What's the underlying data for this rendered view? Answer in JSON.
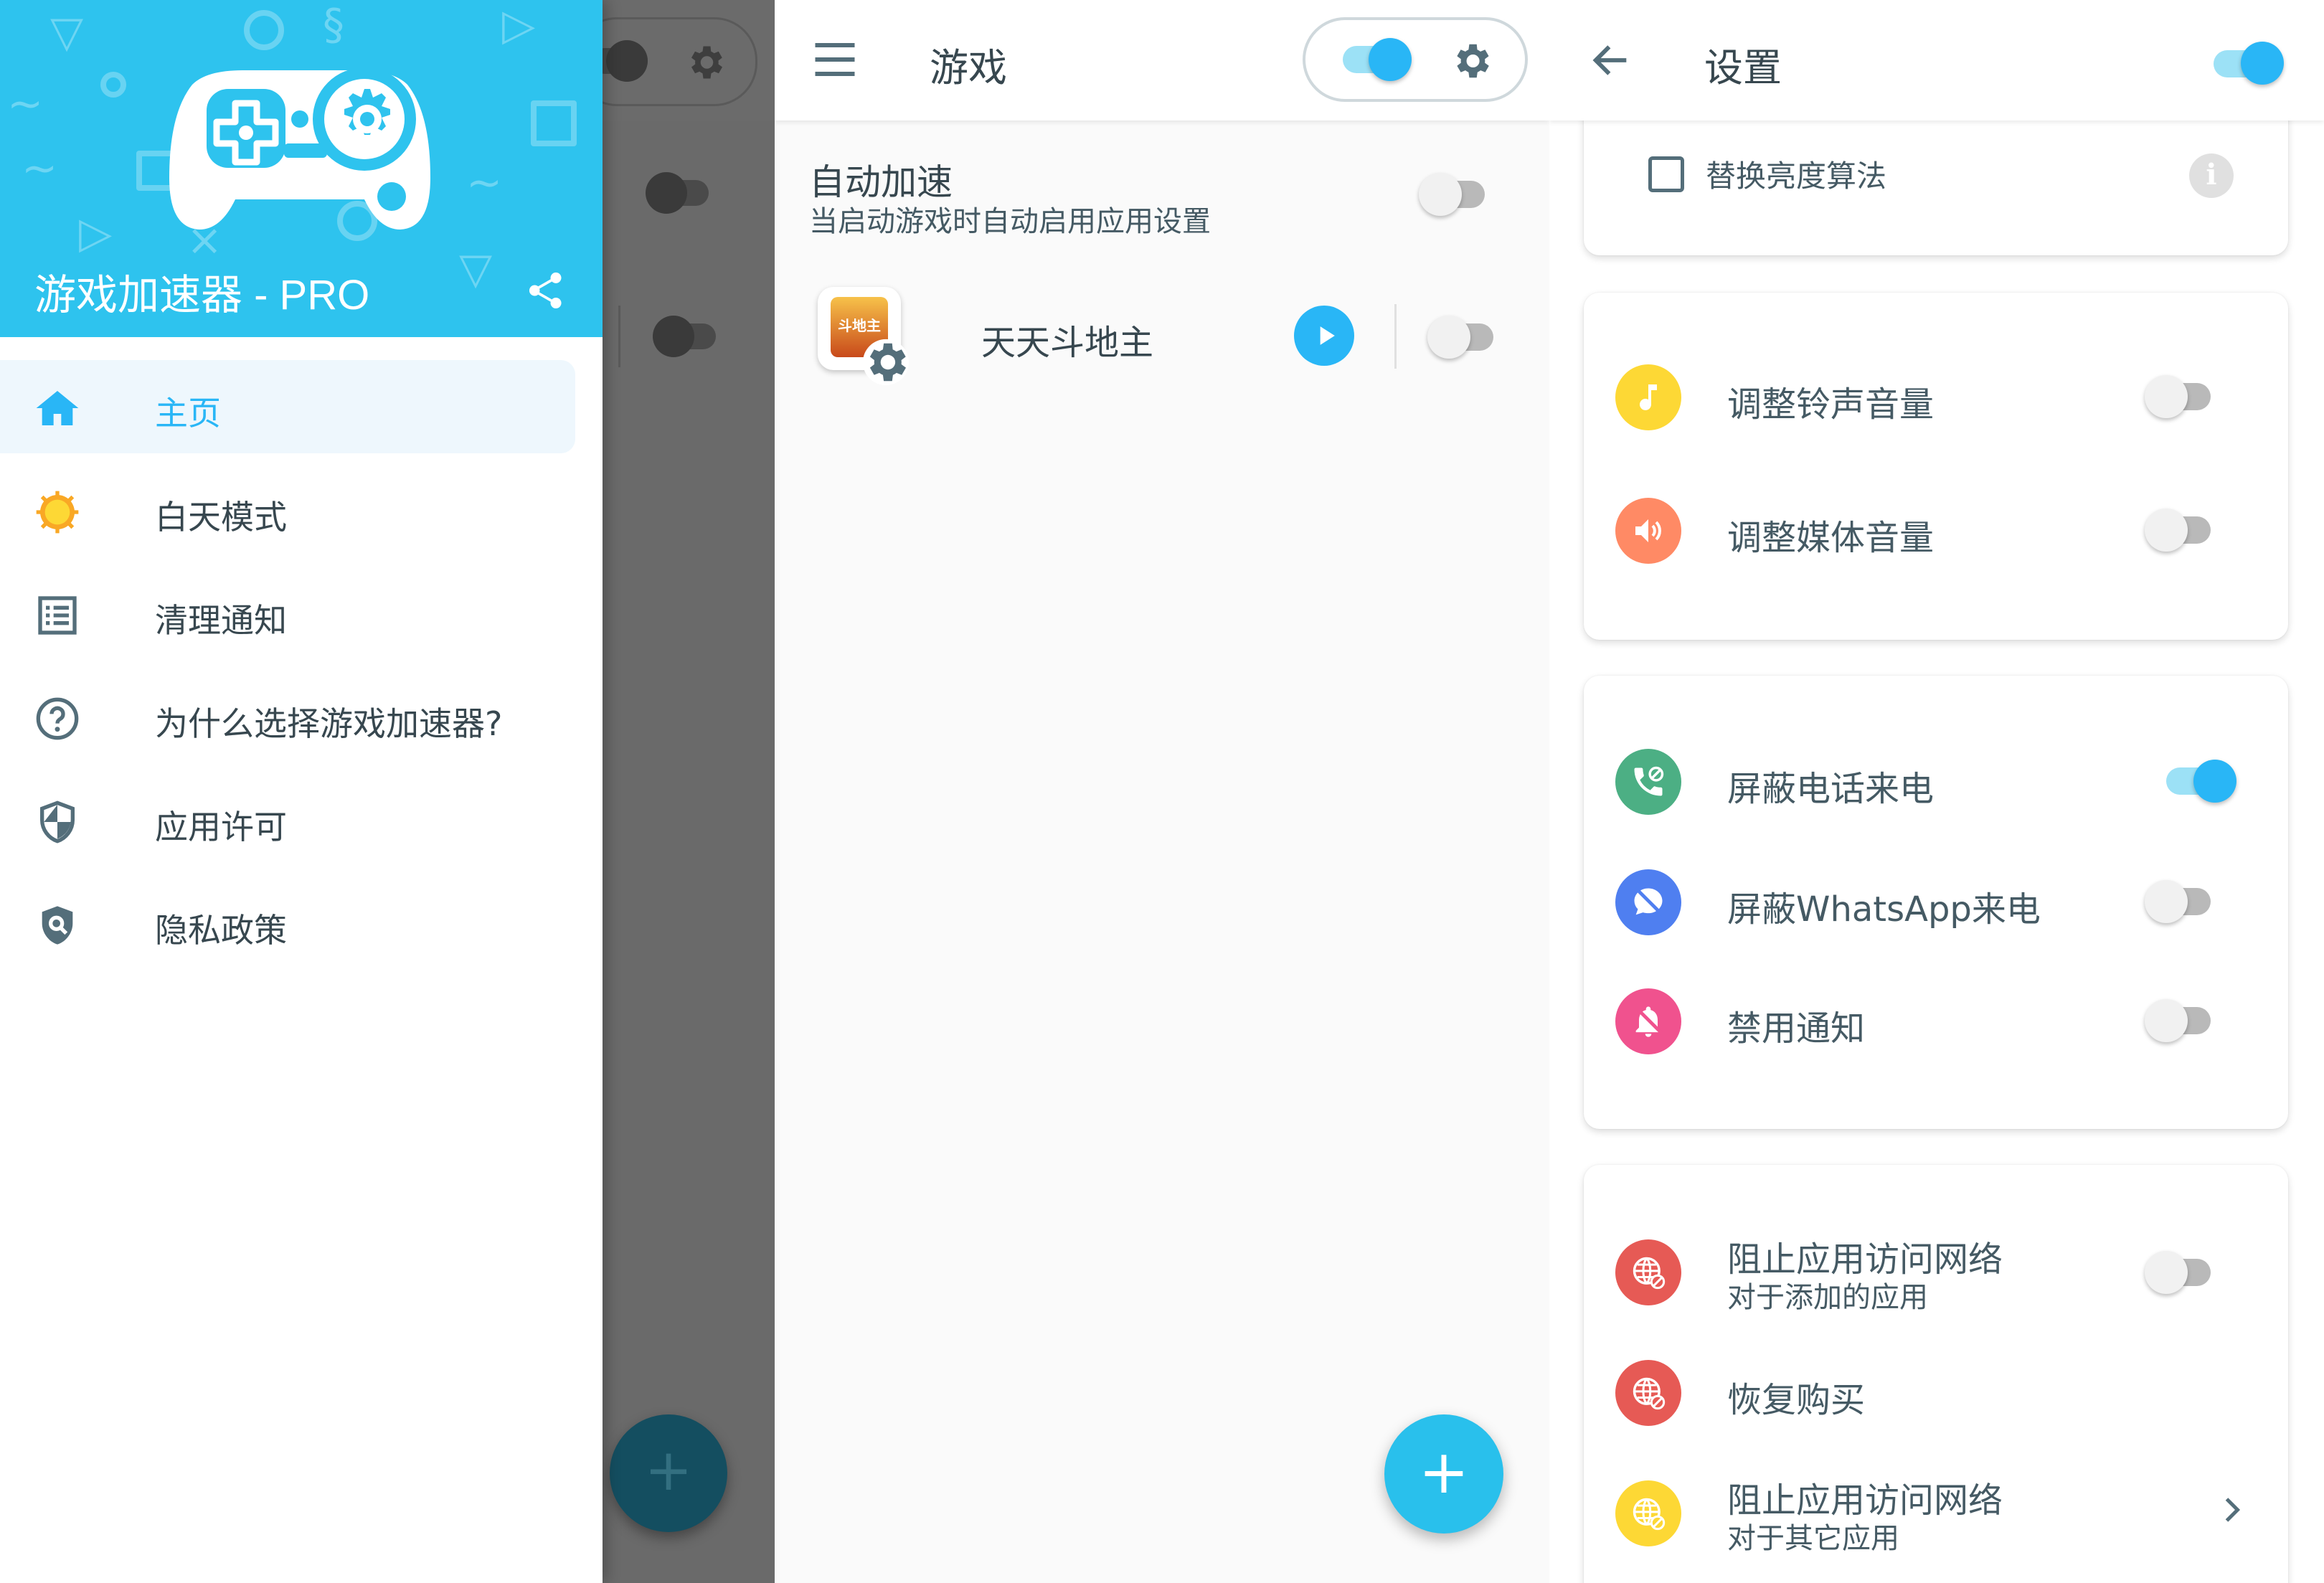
{
  "drawer": {
    "app_title": "游戏加速器 - PRO",
    "header_color": "#2ec3ee",
    "items": [
      {
        "label": "主页",
        "icon": "home-icon",
        "active": true
      },
      {
        "label": "白天模式",
        "icon": "sun-icon"
      },
      {
        "label": "清理通知",
        "icon": "list-icon"
      },
      {
        "label": "为什么选择游戏加速器?",
        "icon": "help-icon"
      },
      {
        "label": "应用许可",
        "icon": "shield-icon"
      },
      {
        "label": "隐私政策",
        "icon": "privacy-shield-icon"
      }
    ]
  },
  "games": {
    "title": "游戏",
    "master_switch": true,
    "auto_boost": {
      "title": "自动加速",
      "subtitle": "当启动游戏时自动启用应用设置",
      "enabled": false
    },
    "list": [
      {
        "name": "天天斗地主",
        "icon_text": "斗地主",
        "enabled": false
      }
    ],
    "fab_label": "+"
  },
  "settings": {
    "title": "设置",
    "master_switch": true,
    "replace_brightness": {
      "label": "替换亮度算法",
      "checked": false
    },
    "sound": [
      {
        "label": "调整铃声音量",
        "icon": "music-note-icon",
        "color": "#fdd835",
        "enabled": false
      },
      {
        "label": "调整媒体音量",
        "icon": "speaker-icon",
        "color": "#ff8a65",
        "enabled": false
      }
    ],
    "calls": [
      {
        "label": "屏蔽电话来电",
        "icon": "phone-block-icon",
        "color": "#4caf84",
        "enabled": true
      },
      {
        "label": "屏蔽WhatsApp来电",
        "icon": "chat-block-icon",
        "color": "#4f7ff0",
        "enabled": false
      },
      {
        "label": "禁用通知",
        "icon": "bell-off-icon",
        "color": "#f0528e",
        "enabled": false
      }
    ],
    "network": [
      {
        "label": "阻止应用访问网络",
        "sublabel": "对于添加的应用",
        "icon": "globe-block-icon",
        "color": "#e65a55",
        "enabled": false
      },
      {
        "label": "恢复购买",
        "icon": "globe-block-icon",
        "color": "#e65a55"
      },
      {
        "label": "阻止应用访问网络",
        "sublabel": "对于其它应用",
        "icon": "globe-block-icon",
        "color": "#fdd835"
      }
    ]
  },
  "colors": {
    "accent": "#29b6f6",
    "text": "#37474f"
  }
}
